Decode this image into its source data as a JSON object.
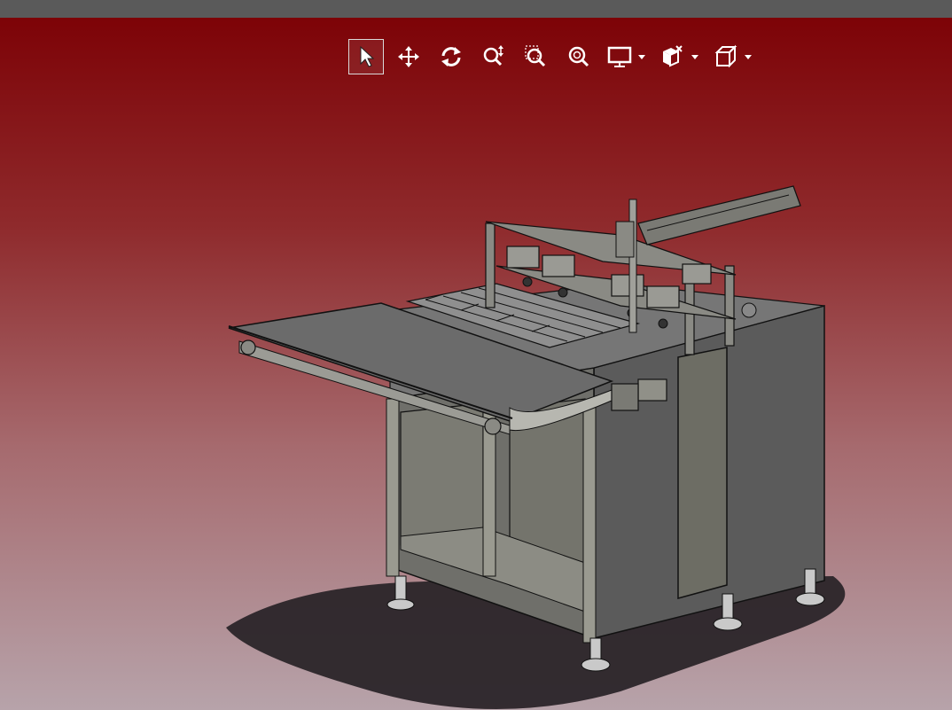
{
  "window": {
    "titlebar_color": "#5a5a5a"
  },
  "viewport": {
    "background_top": "#7d0307",
    "background_bottom": "#b7a3aa"
  },
  "toolbar": {
    "tools": [
      {
        "id": "select",
        "icon": "cursor-arrow-icon",
        "active": true
      },
      {
        "id": "pan",
        "icon": "move-arrows-icon",
        "active": false
      },
      {
        "id": "rotate",
        "icon": "rotate-icon",
        "active": false
      },
      {
        "id": "zoom-in-out",
        "icon": "zoom-in-out-icon",
        "active": false
      },
      {
        "id": "zoom-window",
        "icon": "zoom-window-icon",
        "active": false
      },
      {
        "id": "zoom-fit",
        "icon": "zoom-fit-icon",
        "active": false
      },
      {
        "id": "display-mode",
        "icon": "monitor-icon",
        "has_dropdown": true
      },
      {
        "id": "view-orientation",
        "icon": "view-cube-icon",
        "has_dropdown": true
      },
      {
        "id": "standard-views",
        "icon": "box-icon",
        "has_dropdown": true
      }
    ]
  },
  "model": {
    "description_icon": "machine-assembly-model",
    "colors": {
      "body": "#6a6a6a",
      "body_side": "#5a5a5a",
      "frame": "#8a8a80",
      "shadow": "#2b2529",
      "edges": "#111111"
    }
  }
}
